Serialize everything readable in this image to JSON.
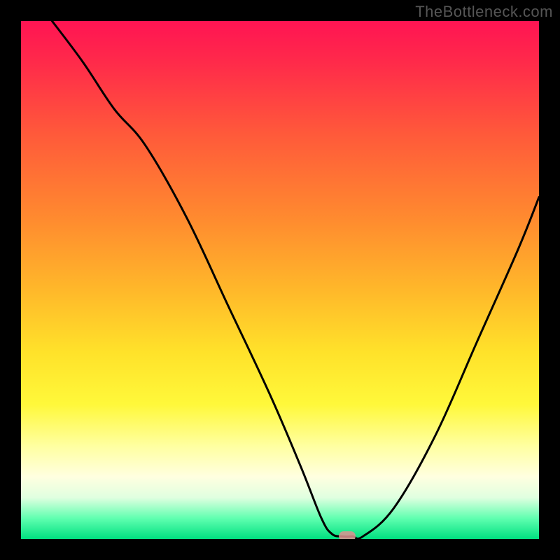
{
  "watermark": "TheBottleneck.com",
  "colors": {
    "curve": "#000000",
    "marker": "#e09090",
    "frame": "#000000"
  },
  "chart_data": {
    "type": "line",
    "title": "",
    "xlabel": "",
    "ylabel": "",
    "xlim": [
      0,
      100
    ],
    "ylim": [
      0,
      100
    ],
    "grid": false,
    "series": [
      {
        "name": "bottleneck-curve",
        "x": [
          6,
          12,
          18,
          24,
          32,
          40,
          48,
          54,
          58,
          60,
          62,
          64,
          66,
          72,
          80,
          88,
          96,
          100
        ],
        "y": [
          100,
          92,
          83,
          76,
          62,
          45,
          28,
          14,
          4,
          1,
          0.5,
          0.5,
          0.5,
          6,
          20,
          38,
          56,
          66
        ]
      }
    ],
    "marker": {
      "x": 63,
      "y": 0.5
    }
  }
}
